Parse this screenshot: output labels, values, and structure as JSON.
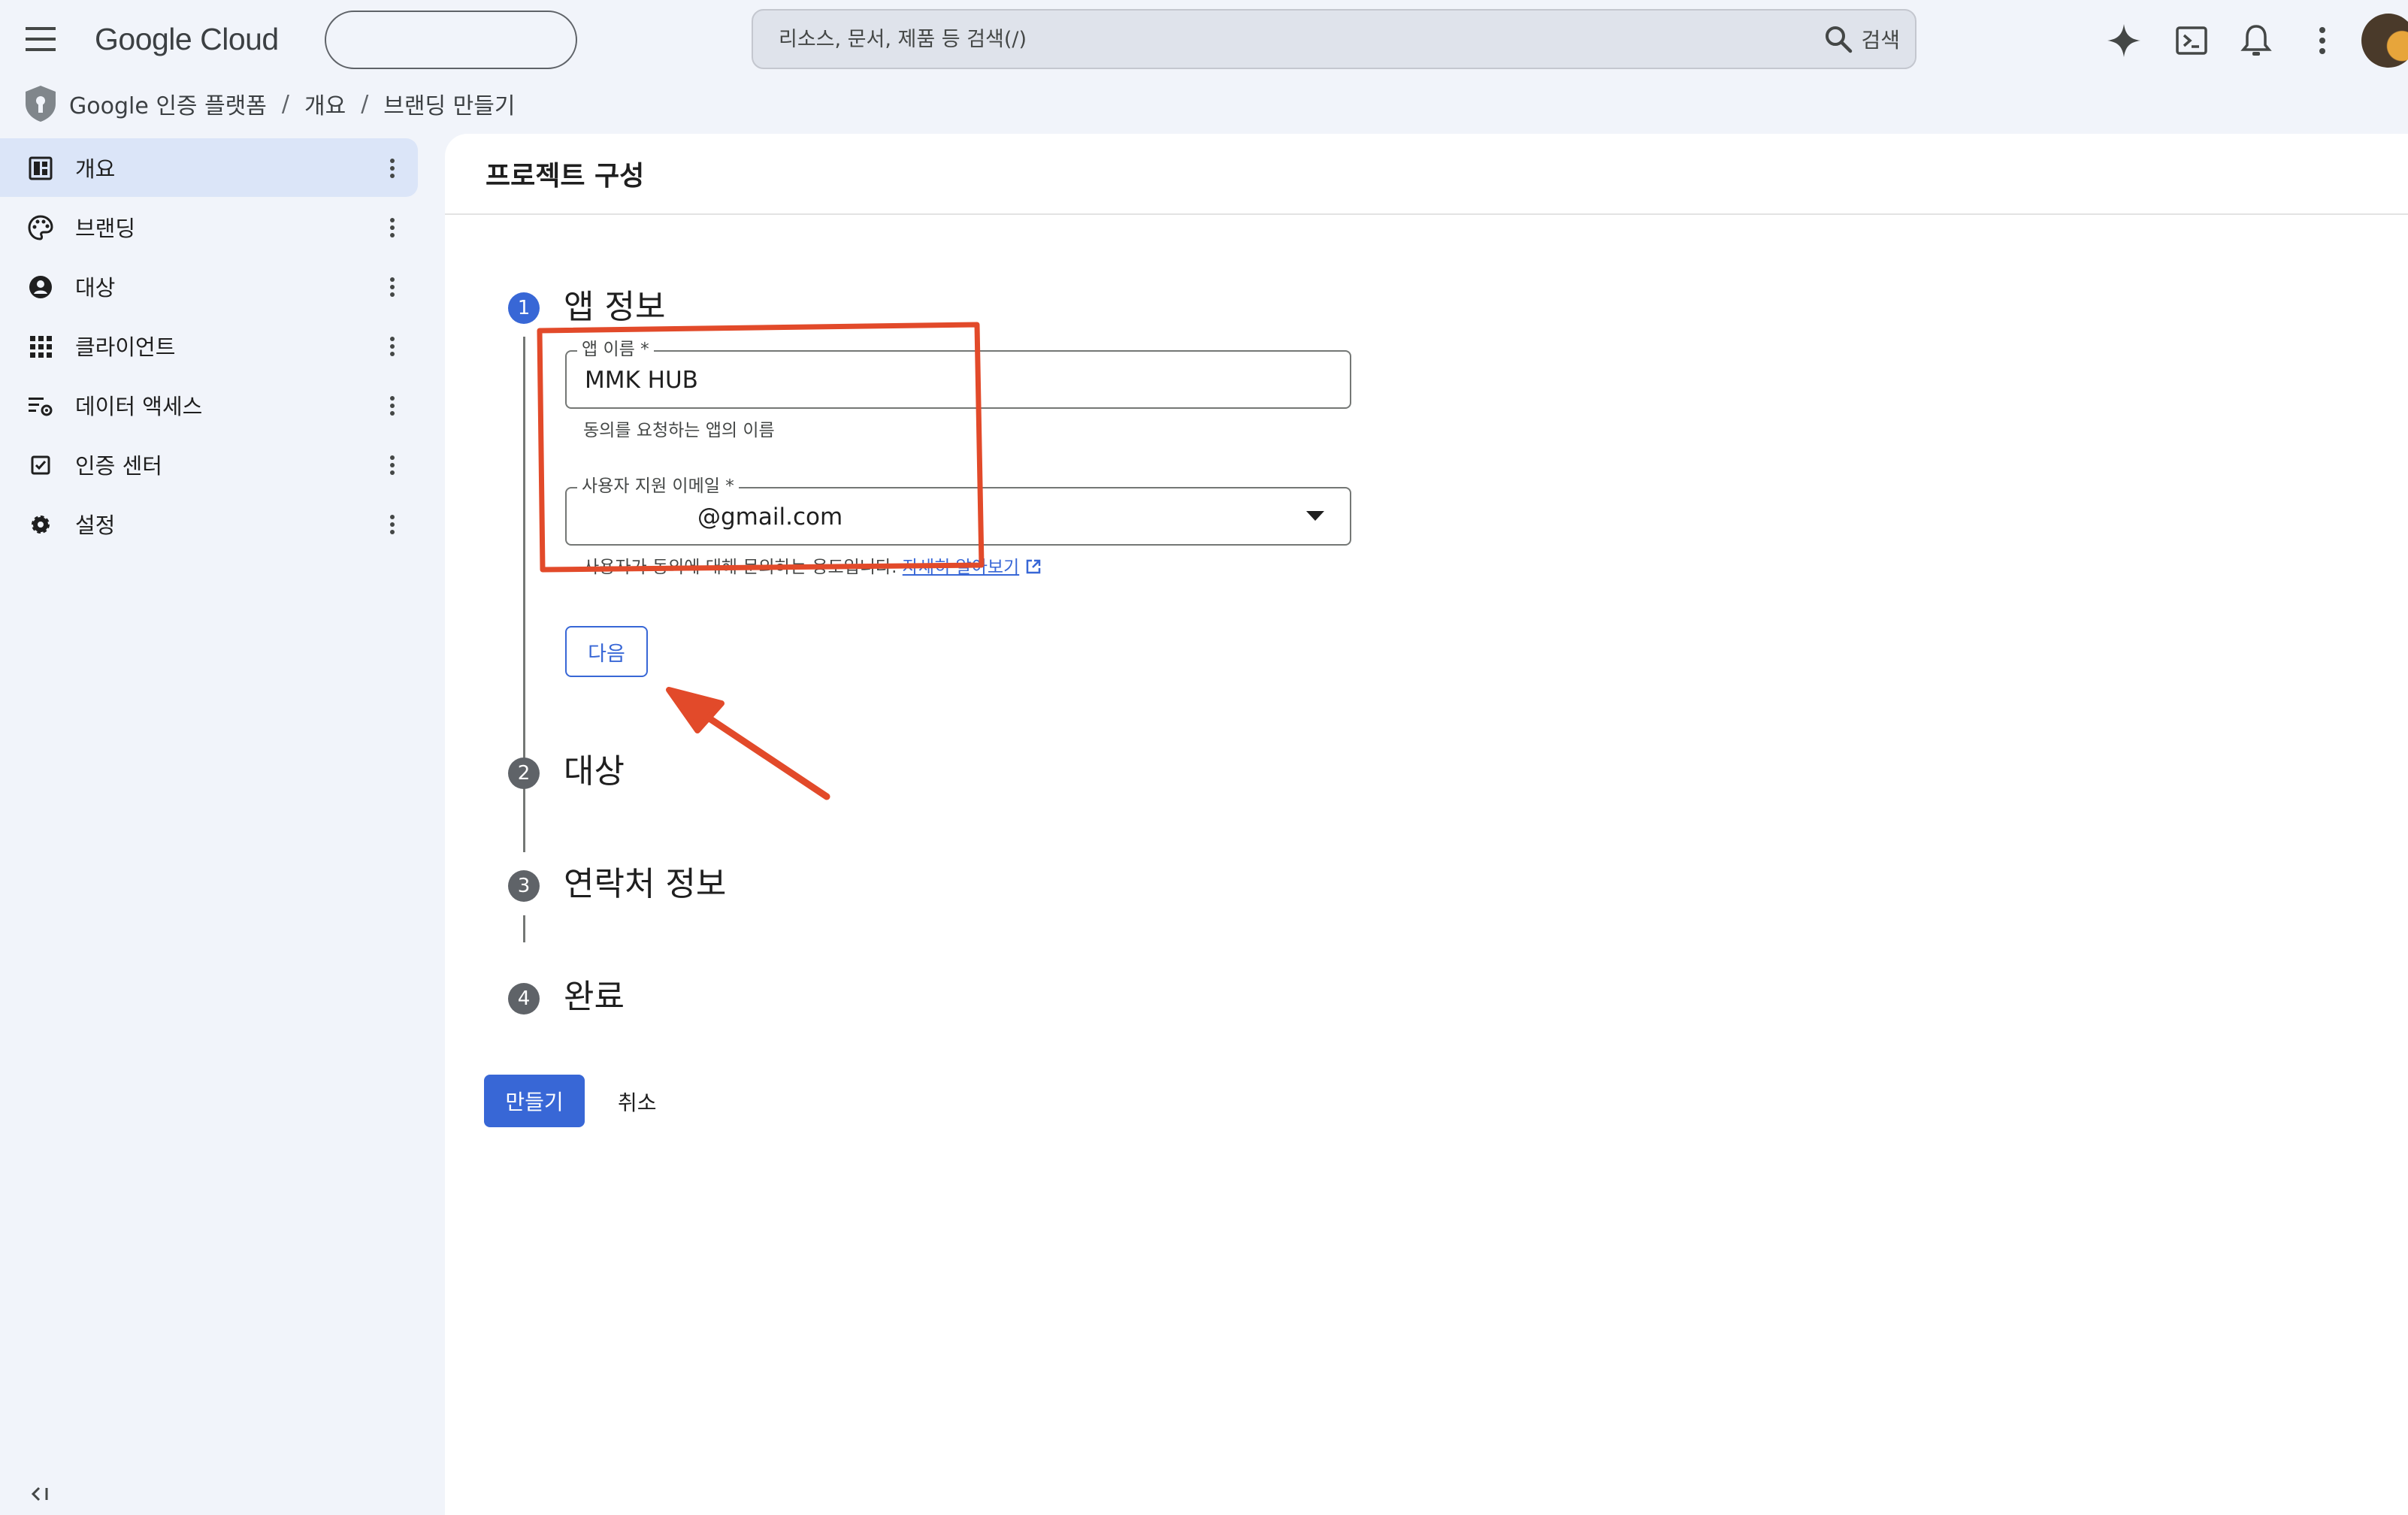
{
  "topbar": {
    "logo": "Google Cloud",
    "search_placeholder": "리소스, 문서, 제품 등 검색(/)",
    "search_button": "검색"
  },
  "breadcrumb": [
    "Google 인증 플랫폼",
    "개요",
    "브랜딩 만들기"
  ],
  "sidebar": {
    "items": [
      {
        "label": "개요",
        "icon": "dashboard-icon",
        "active": true
      },
      {
        "label": "브랜딩",
        "icon": "palette-icon"
      },
      {
        "label": "대상",
        "icon": "account-circle-icon"
      },
      {
        "label": "클라이언트",
        "icon": "apps-grid-icon"
      },
      {
        "label": "데이터 액세스",
        "icon": "data-settings-icon"
      },
      {
        "label": "인증 센터",
        "icon": "verified-checkbox-icon"
      },
      {
        "label": "설정",
        "icon": "gear-icon"
      }
    ]
  },
  "main": {
    "title": "프로젝트 구성",
    "steps": [
      {
        "number": "1",
        "title": "앱 정보"
      },
      {
        "number": "2",
        "title": "대상"
      },
      {
        "number": "3",
        "title": "연락처 정보"
      },
      {
        "number": "4",
        "title": "완료"
      }
    ],
    "app_name": {
      "label": "앱 이름 *",
      "value": "MMK HUB",
      "hint": "동의를 요청하는 앱의 이름"
    },
    "support_email": {
      "label": "사용자 지원 이메일 *",
      "value": "@gmail.com",
      "hint": "사용자가 동의에 대해 문의하는 용도입니다.",
      "link": "자세히 알아보기"
    },
    "next_button": "다음",
    "create_button": "만들기",
    "cancel_button": "취소"
  },
  "colors": {
    "accent": "#3867d6",
    "annotation": "#e24a2a",
    "background": "#f1f4fa"
  }
}
